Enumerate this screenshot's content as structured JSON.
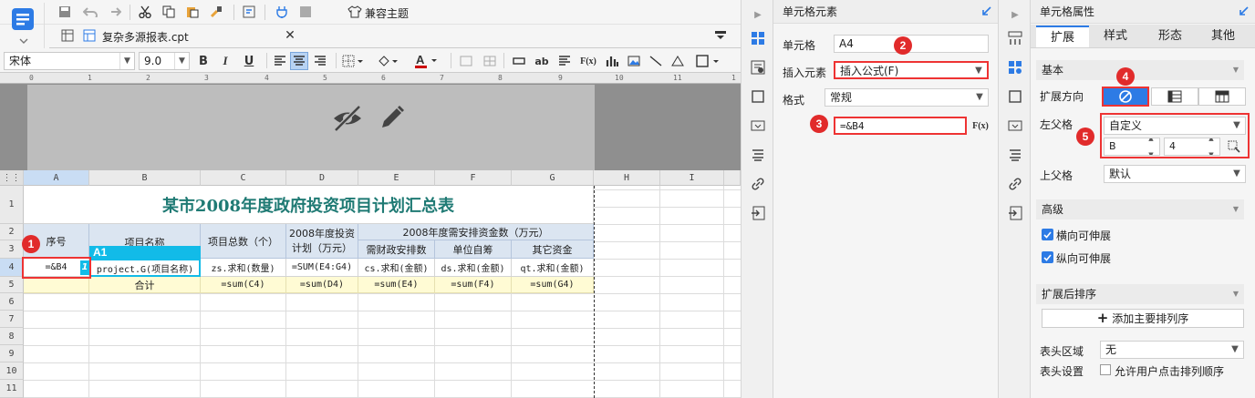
{
  "editor": {
    "file_tab": "复杂多源报表.cpt",
    "theme_button": "兼容主题",
    "font_name": "宋体",
    "font_size": "9.0",
    "text_btn": "ab",
    "formula_btn": "F(x)"
  },
  "grid": {
    "columns": [
      "A",
      "B",
      "C",
      "D",
      "E",
      "F",
      "G",
      "H",
      "I"
    ],
    "rows": [
      "1",
      "2",
      "3",
      "4",
      "5",
      "6",
      "7",
      "8",
      "9",
      "10",
      "11"
    ],
    "title": "某市2008年度政府投资项目计划汇总表",
    "header": {
      "seq": "序号",
      "name": "项目名称",
      "total": "项目总数（个）",
      "plan_line1": "2008年度投资",
      "plan_line2": "计划（万元）",
      "need": "2008年度需安排资金数（万元）",
      "fiscal": "需财政安排数",
      "self": "单位自筹",
      "other": "其它资金"
    },
    "row4": {
      "a": "=&B4",
      "a_num": "1",
      "b": "project.G(项目名称)",
      "b_label": "A1",
      "c": "zs.求和(数量)",
      "d": "=SUM(E4:G4)",
      "e": "cs.求和(金额)",
      "f": "ds.求和(金额)",
      "g": "qt.求和(金额)"
    },
    "row5": {
      "label": "合计",
      "c": "=sum(C4)",
      "d": "=sum(D4)",
      "e": "=sum(E4)",
      "f": "=sum(F4)",
      "g": "=sum(G4)"
    }
  },
  "badges": [
    "1",
    "2",
    "3",
    "4",
    "5"
  ],
  "cell_element": {
    "title": "单元格元素",
    "cell_label": "单元格",
    "cell_value": "A4",
    "insert_label": "插入元素",
    "insert_value": "插入公式(F)",
    "format_label": "格式",
    "format_value": "常规",
    "formula_value": "=&B4",
    "fx": "F(x)"
  },
  "cell_props": {
    "title": "单元格属性",
    "tabs": [
      "扩展",
      "样式",
      "形态",
      "其他"
    ],
    "basic": "基本",
    "expand_dir": "扩展方向",
    "left_parent": "左父格",
    "left_parent_value": "自定义",
    "col_value": "B",
    "row_value": "4",
    "upper_parent": "上父格",
    "upper_parent_value": "默认",
    "advanced": "高级",
    "h_expand": "横向可伸展",
    "v_expand": "纵向可伸展",
    "sort_section": "扩展后排序",
    "add_sort": "添加主要排列序",
    "header_area": "表头区域",
    "header_area_value": "无",
    "header_settings": "表头设置",
    "allow_sort": "允许用户点击排列顺序"
  },
  "colors": {
    "accent": "#2d7be5",
    "header_fill": "#dbe5f1",
    "total_fill": "#fffbd4",
    "title_text": "#1f7a74",
    "badge": "#e12b2b"
  }
}
